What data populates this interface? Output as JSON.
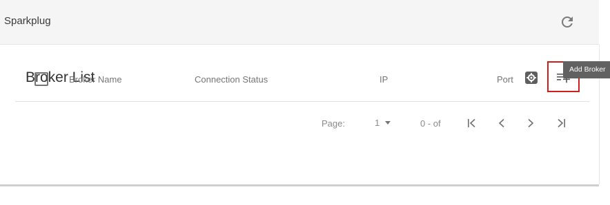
{
  "header": {
    "title": "Sparkplug",
    "refresh_icon": "refresh-icon"
  },
  "broker_list": {
    "title": "Broker List",
    "settings_icon": "settings-icon",
    "add_icon": "playlist-add-icon",
    "add_tooltip": "Add Broker",
    "highlight_color": "#d11c1c",
    "columns": [
      "Broker Name",
      "Connection Status",
      "IP",
      "Port"
    ]
  },
  "pagination": {
    "page_label": "Page:",
    "page_value": "1",
    "range_text": "0 - of",
    "first_icon": "first-page-icon",
    "prev_icon": "chevron-left-icon",
    "next_icon": "chevron-right-icon",
    "last_icon": "last-page-icon"
  }
}
